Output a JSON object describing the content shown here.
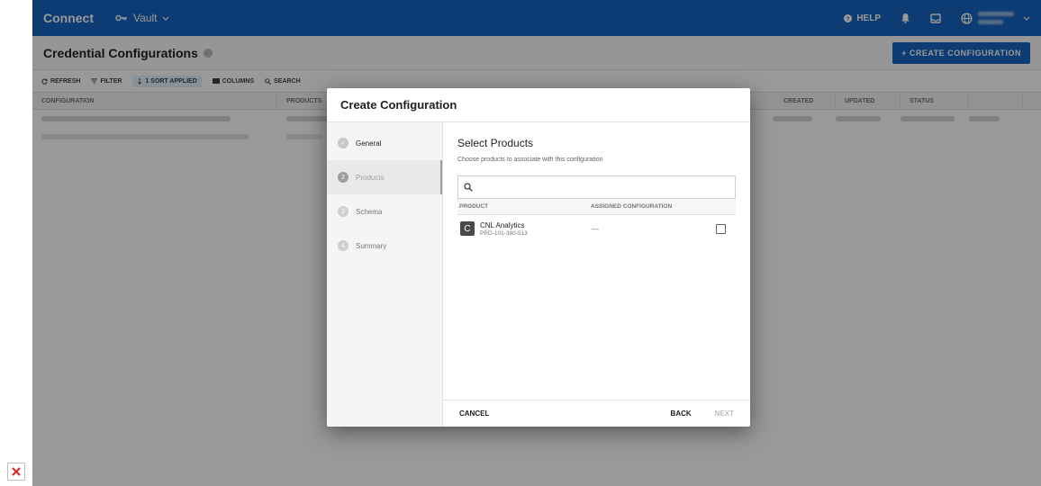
{
  "topbar": {
    "brand": "Connect",
    "module": "Vault",
    "help_label": "HELP"
  },
  "page": {
    "title": "Credential Configurations",
    "create_label": "+ CREATE CONFIGURATION"
  },
  "toolbar": {
    "refresh": "REFRESH",
    "filter": "FILTER",
    "sort": "1 SORT APPLIED",
    "columns": "COLUMNS",
    "search": "SEARCH"
  },
  "table": {
    "columns": [
      "CONFIGURATION",
      "PRODUCTS",
      "CREATED",
      "UPDATED",
      "STATUS"
    ]
  },
  "modal": {
    "title": "Create Configuration",
    "steps": [
      {
        "label": "General",
        "marker": "✓"
      },
      {
        "label": "Products",
        "marker": "2"
      },
      {
        "label": "Schema",
        "marker": "3"
      },
      {
        "label": "Summary",
        "marker": "4"
      }
    ],
    "heading": "Select Products",
    "description": "Choose products to associate with this configuration",
    "search_placeholder": "",
    "columns": [
      "PRODUCT",
      "ASSIGNED CONFIGURATION"
    ],
    "products": [
      {
        "logo": "C",
        "name": "CNL Analytics",
        "id": "PRD-101-380-513",
        "assigned": "—"
      }
    ],
    "cancel_label": "CANCEL",
    "back_label": "BACK",
    "next_label": "NEXT"
  }
}
